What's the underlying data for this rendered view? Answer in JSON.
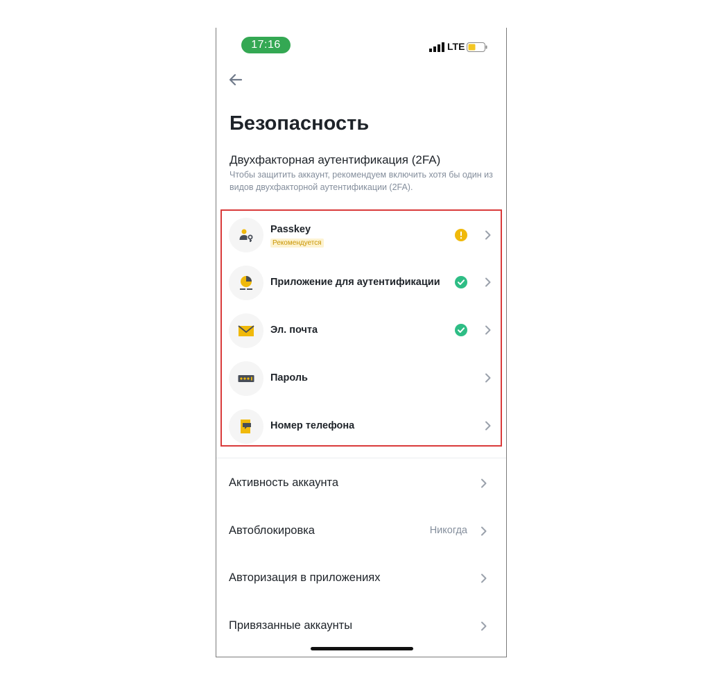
{
  "status_bar": {
    "time": "17:16",
    "network": "LTE",
    "icons": [
      "signal-icon",
      "battery-icon"
    ]
  },
  "header": {
    "back_icon": "arrow-left-icon",
    "title": "Безопасность"
  },
  "twofa": {
    "title": "Двухфакторная аутентификация (2FA)",
    "description": "Чтобы защитить аккаунт, рекомендуем включить хотя бы один из видов двухфакторной аутентификации (2FA).",
    "items": [
      {
        "label": "Passkey",
        "badge": "Рекомендуется",
        "icon": "passkey-icon",
        "status": "warning"
      },
      {
        "label": "Приложение для аутентификации",
        "icon": "authenticator-app-icon",
        "status": "enabled"
      },
      {
        "label": "Эл. почта",
        "icon": "envelope-icon",
        "status": "enabled"
      },
      {
        "label": "Пароль",
        "icon": "password-icon",
        "status": "none"
      },
      {
        "label": "Номер телефона",
        "icon": "phone-icon",
        "status": "none"
      }
    ]
  },
  "menu": {
    "items": [
      {
        "label": "Активность аккаунта"
      },
      {
        "label": "Автоблокировка",
        "value": "Никогда"
      },
      {
        "label": "Авторизация в приложениях"
      },
      {
        "label": "Привязанные аккаунты"
      }
    ]
  },
  "colors": {
    "brand_yellow": "#f0b90b",
    "success_green": "#2ebd85",
    "highlight_red": "#d93a3a",
    "time_pill_green": "#34a853",
    "text_primary": "#1e2329",
    "text_secondary": "#848e9c"
  }
}
